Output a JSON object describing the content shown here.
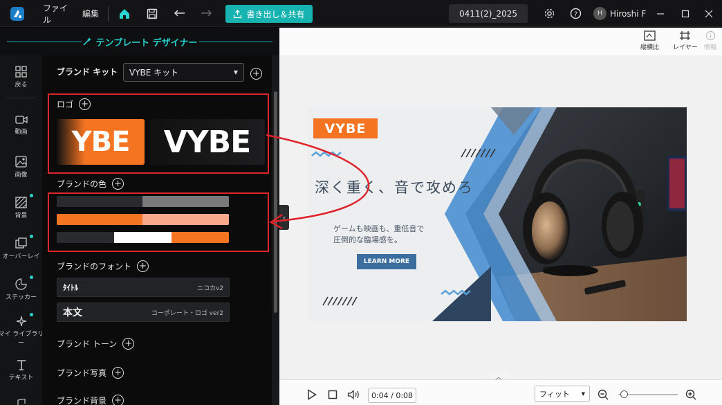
{
  "topbar": {
    "menu_file": "ファイル",
    "menu_edit": "編集",
    "export_label": "書き出し＆共有",
    "project_name": "0411(2)_2025",
    "avatar_initial": "H",
    "username": "Hiroshi F"
  },
  "designer": {
    "title": "テンプレート デザイナー"
  },
  "nav": {
    "back": "戻る",
    "video": "動画",
    "image": "画像",
    "background": "背景",
    "overlay": "オーバーレイ",
    "sticker": "ステッカー",
    "my_library": "マイ ライブラリ",
    "my_library_suffix": "ー",
    "text": "テキスト"
  },
  "brand": {
    "kit_label": "ブランド キット",
    "kit_selected": "VYBE キット",
    "logo_label": "ロゴ",
    "logo_text_1": "YBE",
    "logo_text_2": "VYBE",
    "colors_label": "ブランドの色",
    "fonts_label": "ブランドのフォント",
    "font_title_sample": "ﾀｲﾄﾙ",
    "font_title_name": "ニコカv2",
    "font_body_sample": "本文",
    "font_body_name": "コーポレート・ロゴ ver2",
    "tone_label": "ブランド トーン",
    "photo_label": "ブランド写真",
    "bg_label": "ブランド背景"
  },
  "colors": {
    "accent": "#19b6b3",
    "orange": "#f57421",
    "light_orange": "#f8a98a",
    "dark": "#2a2b2e",
    "grey": "#7a7a7a",
    "highlight_red": "#e0242b",
    "banner_navy": "#2e4560",
    "banner_blue": "#4a8fd0"
  },
  "workspace": {
    "aspect_label": "縦横比",
    "layer_label": "レイヤー",
    "info_label": "情報",
    "time": "0:04 / 0:08",
    "fit_label": "フィット"
  },
  "banner": {
    "logo": "VYBE",
    "headline": "深く重く、音で攻めろ",
    "body_line1": "ゲームも映画も、重低音で",
    "body_line2": "圧倒的な臨場感を。",
    "cta": "LEARN MORE"
  }
}
